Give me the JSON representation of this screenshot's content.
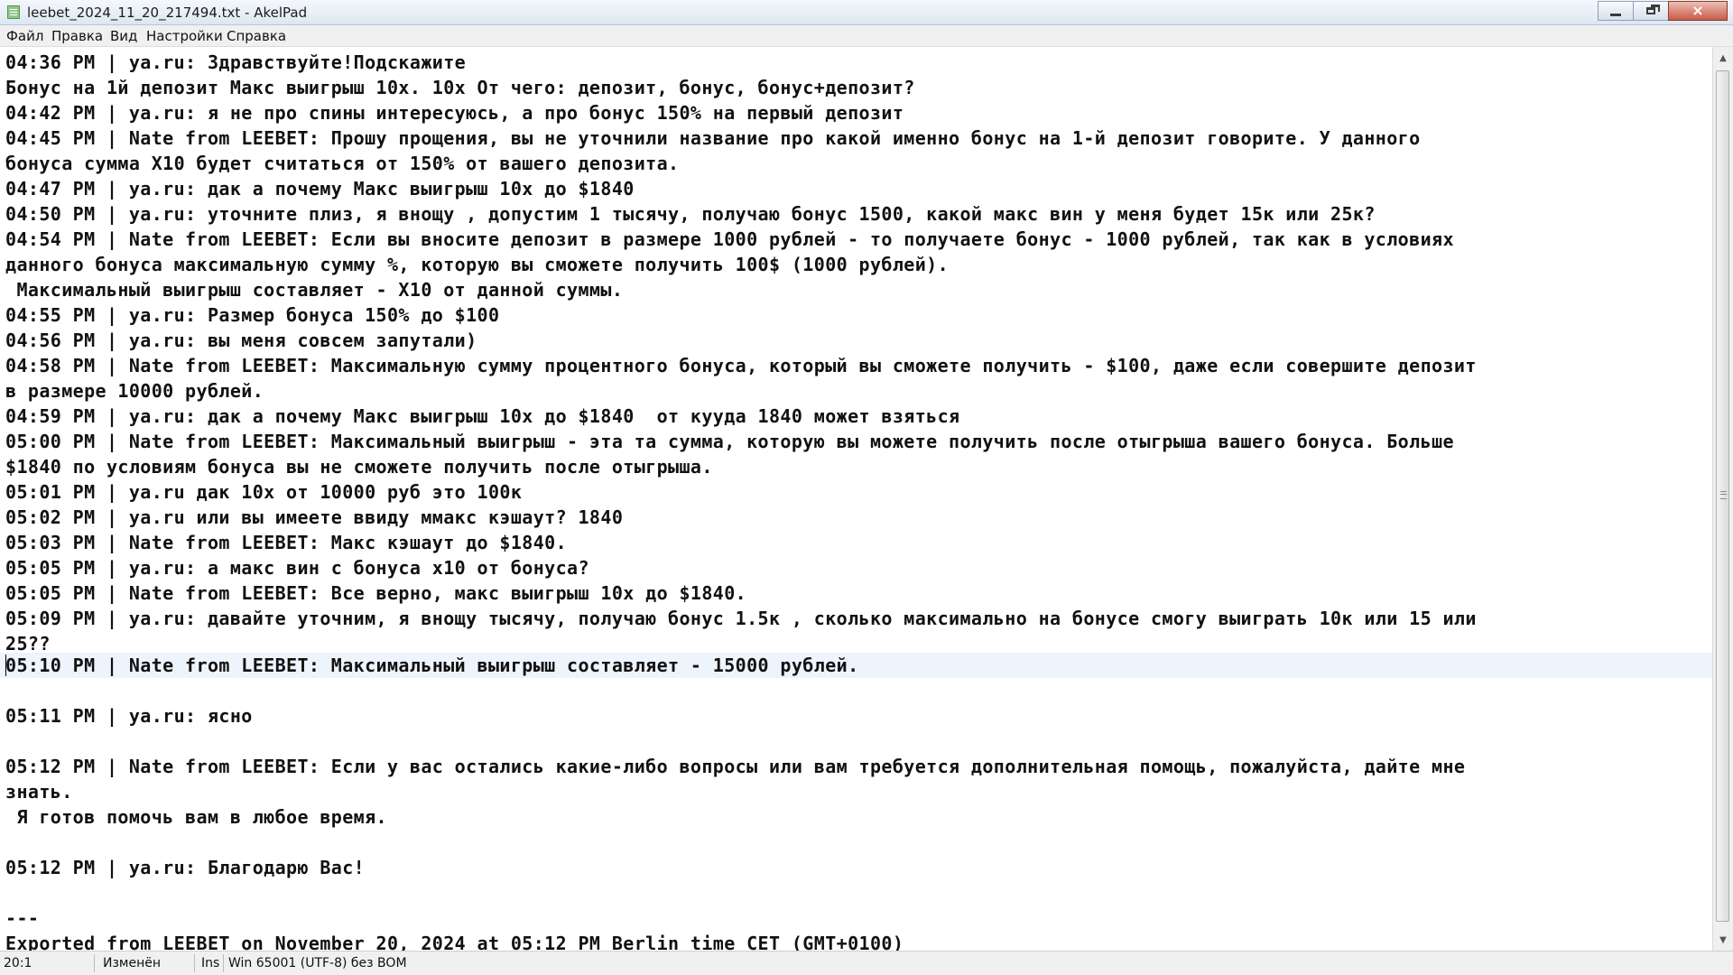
{
  "window": {
    "title": "leebet_2024_11_20_217494.txt - AkelPad",
    "icon": "notepad-document-icon",
    "controls": {
      "minimize": "minimize-icon",
      "maximize": "restore-icon",
      "close": "×"
    }
  },
  "menu": [
    "Файл",
    "Правка",
    "Вид",
    "Настройки",
    "Справка"
  ],
  "document": {
    "lines": [
      "04:36 PM | ya.ru: Здравствуйте!Подскажите",
      "Бонус на 1й депозит Макс выигрыш 10х. 10х От чего: депозит, бонус, бонус+депозит?",
      "04:42 PM | ya.ru: я не про спины интересуюсь, а про бонус 150% на первый депозит",
      "04:45 PM | Nate from LEEBET: Прошу прощения, вы не уточнили название про какой именно бонус на 1-й депозит говорите. У данного",
      "бонуса сумма X10 будет считаться от 150% от вашего депозита.",
      "04:47 PM | ya.ru: дак а почему Макс выигрыш 10х до $1840",
      "04:50 PM | ya.ru: уточните плиз, я внощу , допустим 1 тысячу, получаю бонус 1500, какой макс вин у меня будет 15к или 25к?",
      "04:54 PM | Nate from LEEBET: Если вы вносите депозит в размере 1000 рублей - то получаете бонус - 1000 рублей, так как в условиях",
      "данного бонуса максимальную сумму %, которую вы сможете получить 100$ (1000 рублей).",
      " Максимальный выигрыш составляет - X10 от данной суммы.",
      "04:55 PM | ya.ru: Размер бонуса 150% до $100",
      "04:56 PM | ya.ru: вы меня совсем запутали)",
      "04:58 PM | Nate from LEEBET: Максимальную сумму процентного бонуса, который вы сможете получить - $100, даже если совершите депозит",
      "в размере 10000 рублей.",
      "04:59 PM | ya.ru: дак а почему Макс выигрыш 10х до $1840  от кууда 1840 может взяться",
      "05:00 PM | Nate from LEEBET: Максимальный выигрыш - эта та сумма, которую вы можете получить после отыгрыша вашего бонуса. Больше",
      "$1840 по условиям бонуса вы не сможете получить после отыгрыша.",
      "05:01 PM | ya.ru дак 10х от 10000 руб это 100к",
      "05:02 PM | ya.ru или вы имеете ввиду ммакс кэшаут? 1840",
      "05:03 PM | Nate from LEEBET: Макс кэшаут до $1840.",
      "05:05 PM | ya.ru: а макс вин с бонуса х10 от бонуса?",
      "05:05 PM | Nate from LEEBET: Все верно, макс выигрыш 10х до $1840.",
      "05:09 PM | ya.ru: давайте уточним, я внощу тысячу, получаю бонус 1.5к , сколько максимально на бонусе смогу выиграть 10к или 15 или",
      "25??",
      "05:10 PM | Nate from LEEBET: Максимальный выигрыш составляет - 15000 рублей.",
      "",
      "05:11 PM | ya.ru: ясно",
      "",
      "05:12 PM | Nate from LEEBET: Если у вас остались какие-либо вопросы или вам требуется дополнительная помощь, пожалуйста, дайте мне",
      "знать.",
      " Я готов помочь вам в любое время.",
      "",
      "05:12 PM | ya.ru: Благодарю Вас!",
      "",
      "---",
      "Exported from LEEBET on November 20, 2024 at 05:12 PM Berlin time CET (GMT+0100)"
    ]
  },
  "status": {
    "position": "20:1",
    "modified": "Изменён",
    "insert_mode": "Ins",
    "encoding": "Win  65001 (UTF-8)  без BOM"
  },
  "colors": {
    "current_line": "#eef4fb",
    "text": "#111111",
    "titlebar": "#dde6f1",
    "close_button": "#c95a46"
  }
}
